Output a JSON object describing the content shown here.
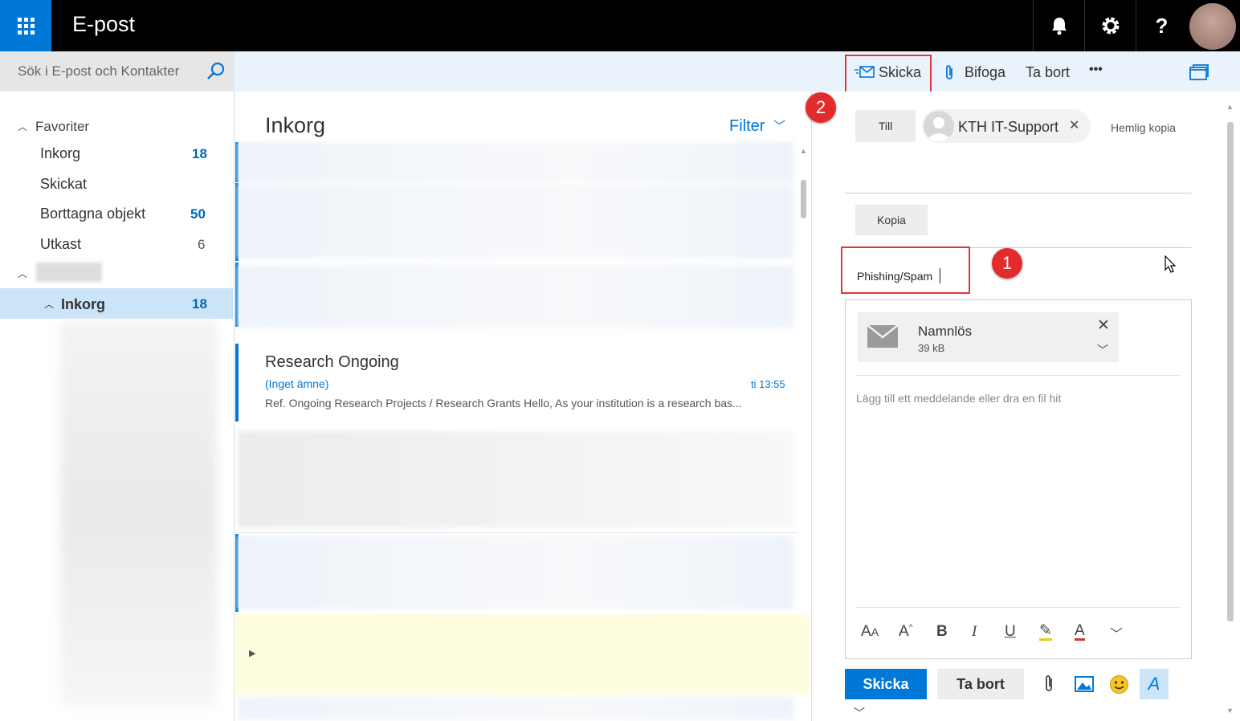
{
  "header": {
    "app_title": "E-post",
    "icons": [
      "waffle-icon",
      "bell-icon",
      "gear-icon",
      "help-icon",
      "avatar"
    ]
  },
  "search": {
    "placeholder": "Sök i E-post och Kontakter"
  },
  "toolbar": {
    "send_label": "Skicka",
    "attach_label": "Bifoga",
    "delete_label": "Ta bort",
    "more_label": "•••"
  },
  "sidebar": {
    "favorites_label": "Favoriter",
    "favorites": [
      {
        "label": "Inkorg",
        "count": "18"
      },
      {
        "label": "Skickat",
        "count": ""
      },
      {
        "label": "Borttagna objekt",
        "count": "50"
      },
      {
        "label": "Utkast",
        "count": "6"
      }
    ],
    "inbox_label": "Inkorg",
    "inbox_count": "18"
  },
  "message_list": {
    "title": "Inkorg",
    "filter_label": "Filter",
    "selected_message": {
      "sender": "Research Ongoing",
      "subject": "(Inget ämne)",
      "time": "ti 13:55",
      "preview": "Ref. Ongoing Research Projects / Research Grants Hello, As your institution is a research bas..."
    }
  },
  "compose": {
    "to_label": "Till",
    "recipient": "KTH IT-Support",
    "bcc_label": "Hemlig kopia",
    "cc_label": "Kopia",
    "subject": "Phishing/Spam",
    "attachment": {
      "name": "Namnlös",
      "size": "39 kB"
    },
    "body_placeholder": "Lägg till ett meddelande eller dra en fil hit",
    "send_label": "Skicka",
    "discard_label": "Ta bort"
  },
  "annotations": {
    "badge_1": "1",
    "badge_2": "2"
  },
  "colors": {
    "accent": "#0078d7",
    "annotation_red": "#e0373f",
    "topbar": "#000000"
  }
}
